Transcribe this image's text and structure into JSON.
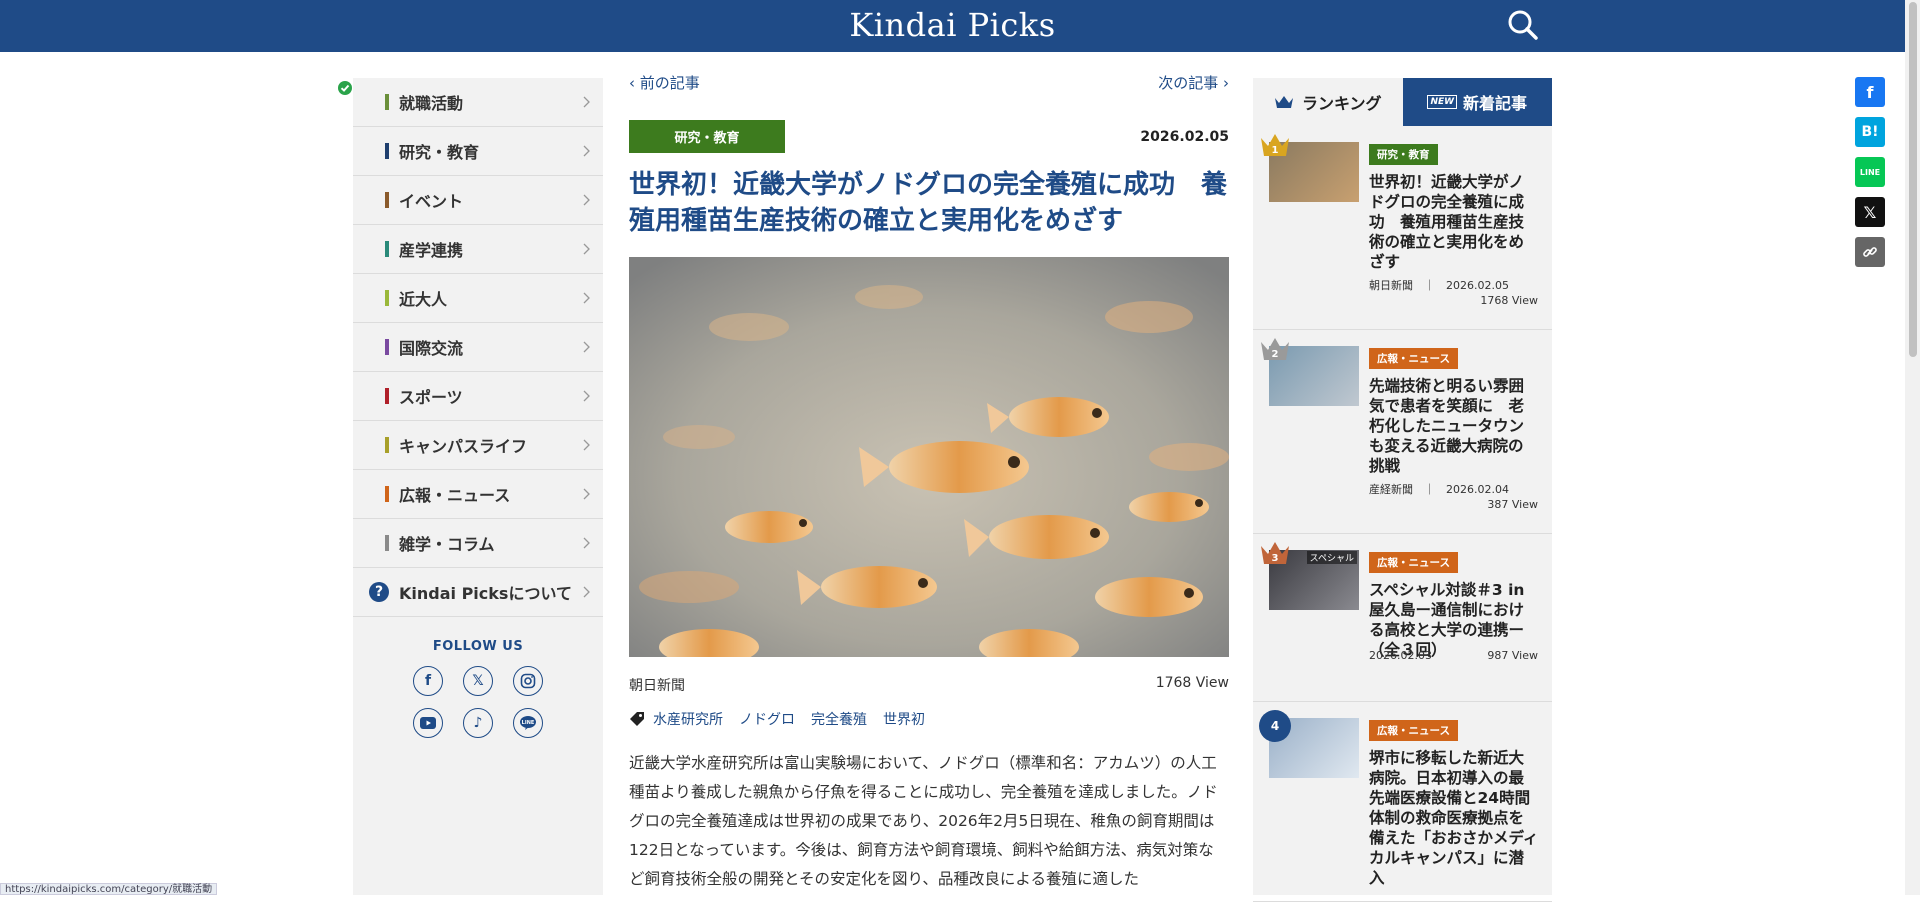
{
  "header": {
    "logo": "Kindai Picks"
  },
  "nav": {
    "items": [
      {
        "label": "就職活動",
        "color": "#6a8f3a"
      },
      {
        "label": "研究・教育",
        "color": "#1f3f6e"
      },
      {
        "label": "イベント",
        "color": "#8a5a2b"
      },
      {
        "label": "産学連携",
        "color": "#2a8a7a"
      },
      {
        "label": "近大人",
        "color": "#9ab83a"
      },
      {
        "label": "国際交流",
        "color": "#7a4aa0"
      },
      {
        "label": "スポーツ",
        "color": "#b0202a"
      },
      {
        "label": "キャンパスライフ",
        "color": "#a8a02a"
      },
      {
        "label": "広報・ニュース",
        "color": "#d0651a"
      },
      {
        "label": "雑学・コラム",
        "color": "#8a8a8a"
      }
    ],
    "about": "Kindai Picksについて",
    "follow": "FOLLOW US",
    "social": [
      "facebook-icon",
      "x-icon",
      "instagram-icon",
      "youtube-icon",
      "tiktok-icon",
      "line-icon"
    ]
  },
  "article": {
    "prev": "前の記事",
    "next": "次の記事",
    "category": "研究・教育",
    "date": "2026.02.05",
    "title": "世界初！近畿大学がノドグロの完全養殖に成功　養殖用種苗生産技術の確立と実用化をめざす",
    "source": "朝日新聞",
    "views": "1768 View",
    "tags": [
      "水産研究所",
      "ノドグロ",
      "完全養殖",
      "世界初"
    ],
    "body": "近畿大学水産研究所は富山実験場において、ノドグロ（標準和名：アカムツ）の人工種苗より養成した親魚から仔魚を得ることに成功し、完全養殖を達成しました。ノドグロの完全養殖達成は世界初の成果であり、2026年2月5日現在、稚魚の飼育期間は122日となっています。今後は、飼育方法や飼育環境、飼料や給餌方法、病気対策など飼育技術全般の開発とその安定化を図り、品種改良による養殖に適した"
  },
  "ranking": {
    "tab_rank": "ランキング",
    "tab_new": "新着記事",
    "new_mark": "NEW",
    "items": [
      {
        "rank": "1",
        "category": "研究・教育",
        "cat_color": "#3d7b1e",
        "title": "世界初！近畿大学がノドグロの完全養殖に成功　養殖用種苗生産技術の確立と実用化をめざす",
        "source": "朝日新聞",
        "date": "2026.02.05",
        "views": "1768 View",
        "crown": "#d9a520"
      },
      {
        "rank": "2",
        "category": "広報・ニュース",
        "cat_color": "#d0651a",
        "title": "先端技術と明るい雰囲気で患者を笑顔に　老朽化したニュータウンも変える近畿大病院の挑戦",
        "source": "産経新聞",
        "date": "2026.02.04",
        "views": "387 View",
        "crown": "#9a9a9a"
      },
      {
        "rank": "3",
        "category": "広報・ニュース",
        "cat_color": "#d0651a",
        "title": "スペシャル対談＃3 in屋久島ー通信制における高校と大学の連携ー（全３回）",
        "source": "",
        "date": "2026.02.03",
        "views": "987 View",
        "crown": "#c0653a",
        "thumb_label": "スペシャル"
      },
      {
        "rank": "4",
        "category": "広報・ニュース",
        "cat_color": "#d0651a",
        "title": "堺市に移転した新近大病院。日本初導入の最先端医療設備と24時間体制の救命医療拠点を備えた「おおさかメディカルキャンパス」に潜入",
        "source": "",
        "date": "",
        "views": ""
      }
    ]
  },
  "share": [
    "facebook-icon",
    "hatena-icon",
    "line-icon",
    "x-icon",
    "link-icon"
  ],
  "status_url": "https://kindaipicks.com/category/就職活動"
}
